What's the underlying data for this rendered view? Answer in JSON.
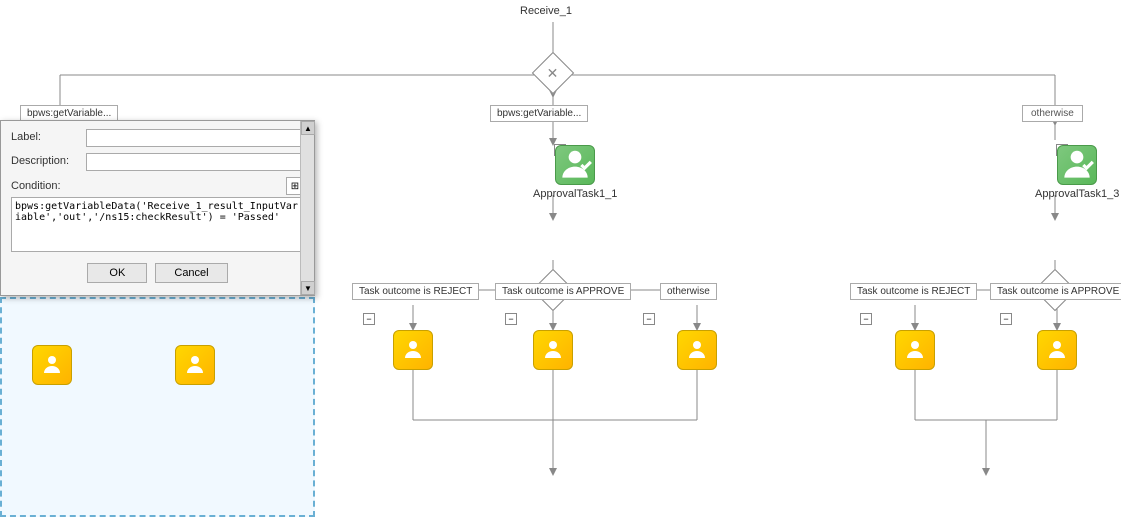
{
  "canvas": {
    "background": "white"
  },
  "nodes": {
    "receive1": {
      "label": "Receive_1"
    },
    "topGateway": {
      "symbol": "✕"
    },
    "getvar_left": {
      "label": "bpws:getVariable..."
    },
    "getvar_center": {
      "label": "bpws:getVariable..."
    },
    "otherwise_top": {
      "label": "otherwise"
    },
    "approvalTask1": {
      "label": "ApprovalTask1_1"
    },
    "approvalTask3": {
      "label": "ApprovalTask1_3"
    },
    "gateway_center": {
      "symbol": "✕"
    },
    "gateway_right": {
      "symbol": "✕"
    },
    "condition_reject_center": {
      "label": "Task outcome is REJECT"
    },
    "condition_approve_center": {
      "label": "Task outcome is APPROVE"
    },
    "condition_otherwise_center": {
      "label": "otherwise"
    },
    "condition_reject_right": {
      "label": "Task outcome is REJECT"
    },
    "condition_approve_right": {
      "label": "Task outcome is APPROVE"
    }
  },
  "dialog": {
    "label_field": {
      "label": "Label:",
      "value": "",
      "placeholder": ""
    },
    "description_field": {
      "label": "Description:",
      "value": "",
      "placeholder": ""
    },
    "condition_field": {
      "label": "Condition:",
      "value": "bpws:getVariableData('Receive_1_result_InputVariable','out','/ns15:checkResult') = 'Passed'"
    },
    "ok_button": "OK",
    "cancel_button": "Cancel"
  }
}
